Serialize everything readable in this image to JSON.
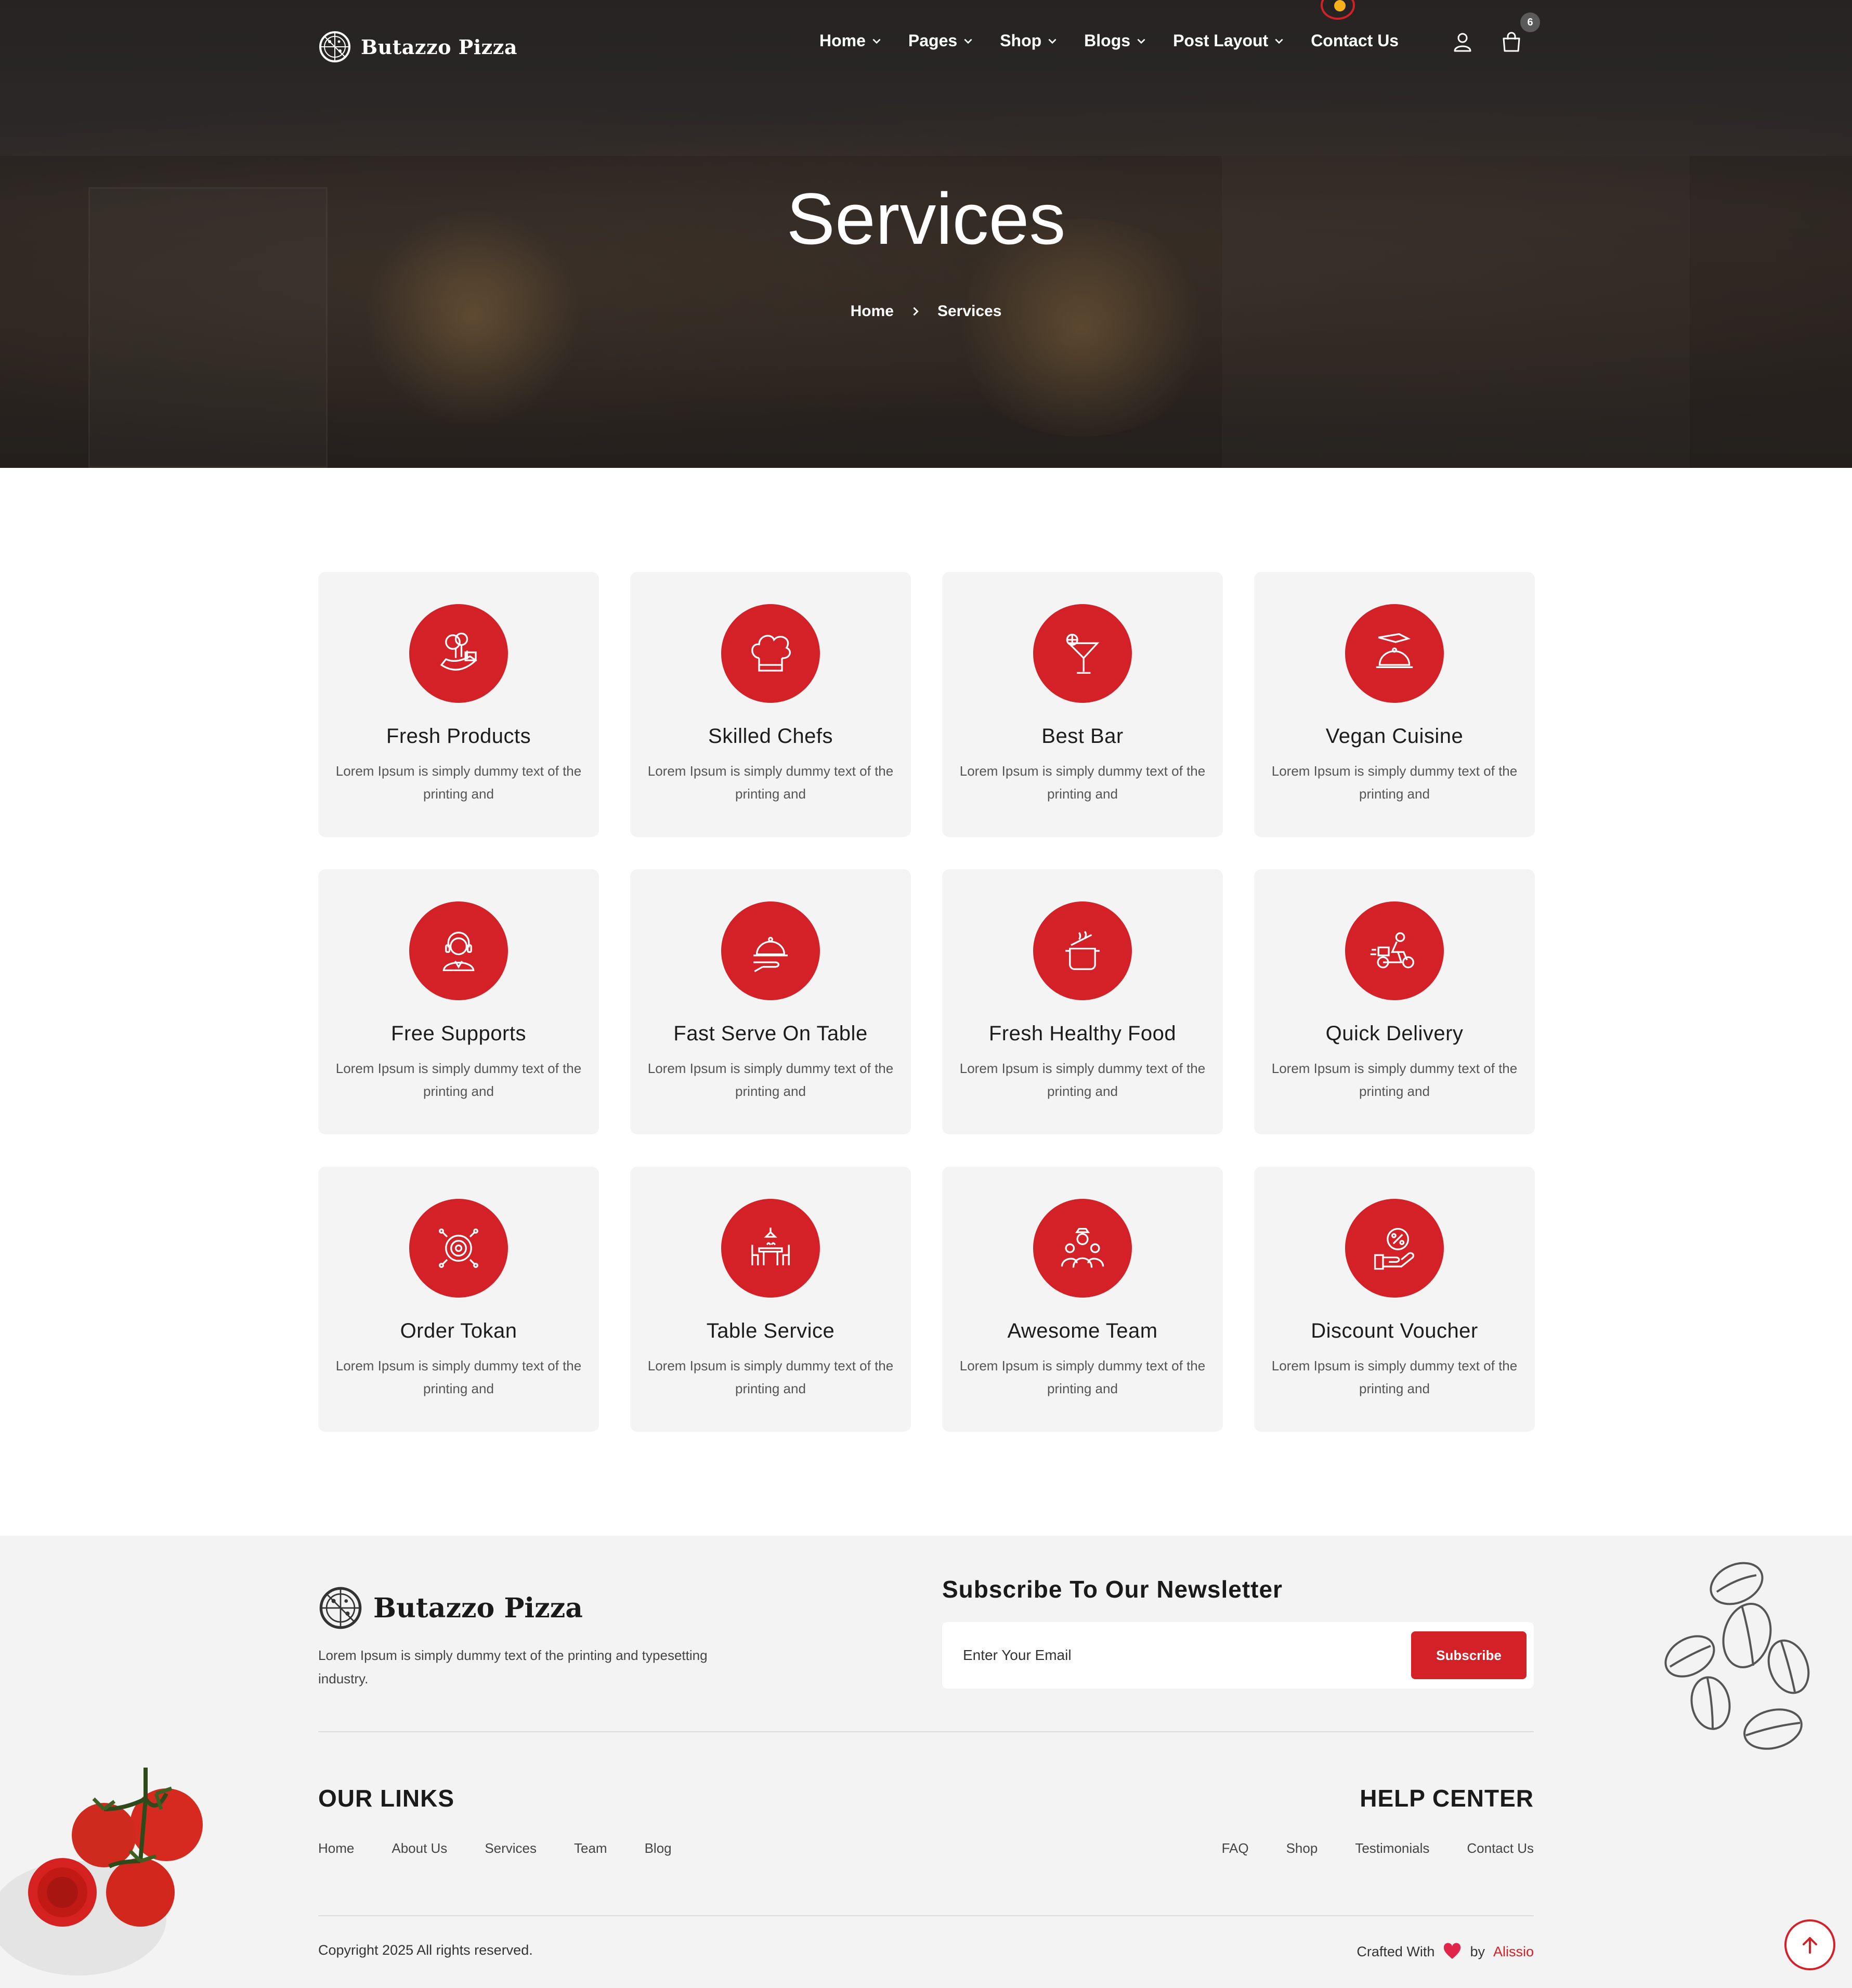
{
  "brand": {
    "name": "Butazzo Pizza",
    "accent": "#d32127"
  },
  "nav": {
    "items": [
      {
        "label": "Home",
        "dropdown": true
      },
      {
        "label": "Pages",
        "dropdown": true
      },
      {
        "label": "Shop",
        "dropdown": true
      },
      {
        "label": "Blogs",
        "dropdown": true
      },
      {
        "label": "Post Layout",
        "dropdown": true
      },
      {
        "label": "Contact Us",
        "dropdown": false
      }
    ],
    "account_icon": "user-icon",
    "cart_icon": "shopping-bag-icon",
    "cart_count": "6"
  },
  "hero": {
    "title": "Services",
    "breadcrumb": [
      "Home",
      "Services"
    ]
  },
  "services": [
    {
      "title": "Fresh Products",
      "text": "Lorem Ipsum is simply dummy text of the printing and",
      "icon": "vegetables-icon"
    },
    {
      "title": "Skilled Chefs",
      "text": "Lorem Ipsum is simply dummy text of the printing and",
      "icon": "chef-hat-icon"
    },
    {
      "title": "Best Bar",
      "text": "Lorem Ipsum is simply dummy text of the printing and",
      "icon": "cocktail-icon"
    },
    {
      "title": "Vegan Cuisine",
      "text": "Lorem Ipsum is simply dummy text of the printing and",
      "icon": "cloche-hand-icon"
    },
    {
      "title": "Free Supports",
      "text": "Lorem Ipsum is simply dummy text of the printing and",
      "icon": "headset-support-icon"
    },
    {
      "title": "Fast Serve On Table",
      "text": "Lorem Ipsum is simply dummy text of the printing and",
      "icon": "serving-tray-icon"
    },
    {
      "title": "Fresh Healthy Food",
      "text": "Lorem Ipsum is simply dummy text of the printing and",
      "icon": "cooking-pot-icon"
    },
    {
      "title": "Quick Delivery",
      "text": "Lorem Ipsum is simply dummy text of the printing and",
      "icon": "delivery-scooter-icon"
    },
    {
      "title": "Order Tokan",
      "text": "Lorem Ipsum is simply dummy text of the printing and",
      "icon": "target-token-icon"
    },
    {
      "title": "Table Service",
      "text": "Lorem Ipsum is simply dummy text of the printing and",
      "icon": "dining-table-icon"
    },
    {
      "title": "Awesome Team",
      "text": "Lorem Ipsum is simply dummy text of the printing and",
      "icon": "team-icon"
    },
    {
      "title": "Discount Voucher",
      "text": "Lorem Ipsum is simply dummy text of the printing and",
      "icon": "discount-hand-icon"
    }
  ],
  "footer": {
    "brand": "Butazzo Pizza",
    "description": "Lorem Ipsum is simply dummy text of the printing and typesetting industry.",
    "newsletter": {
      "title": "Subscribe To Our Newsletter",
      "placeholder": "Enter Your Email",
      "button": "Subscribe"
    },
    "our_links": {
      "title": "OUR LINKS",
      "items": [
        "Home",
        "About Us",
        "Services",
        "Team",
        "Blog"
      ]
    },
    "help_center": {
      "title": "HELP CENTER",
      "items": [
        "FAQ",
        "Shop",
        "Testimonials",
        "Contact Us"
      ]
    },
    "copyright": "Copyright 2025 All rights reserved.",
    "crafted_prefix": "Crafted With",
    "crafted_by": "by",
    "author": "Alissio"
  },
  "scroll_top_icon": "arrow-up-icon"
}
